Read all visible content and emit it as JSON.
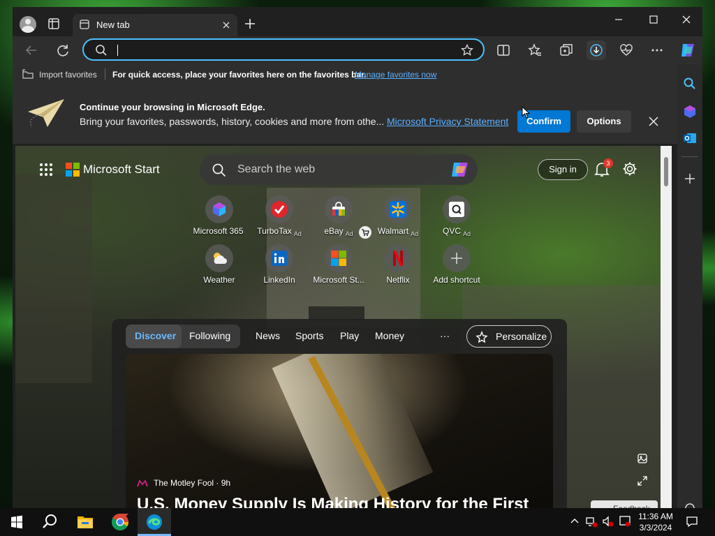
{
  "browser": {
    "tab_title": "New tab",
    "address_value": "",
    "address_placeholder": ""
  },
  "favorites_bar": {
    "import_label": "Import favorites",
    "hint_text": "For quick access, place your favorites here on the favorites bar.",
    "manage_link": "Manage favorites now"
  },
  "infobar": {
    "title": "Continue your browsing in Microsoft Edge.",
    "body": "Bring your favorites, passwords, history, cookies and more from othe...",
    "privacy_link": "Microsoft Privacy Statement",
    "confirm_label": "Confirm",
    "options_label": "Options"
  },
  "page": {
    "brand": "Microsoft Start",
    "search_placeholder": "Search the web",
    "sign_in_label": "Sign in",
    "notification_count": "3",
    "shortcuts": [
      {
        "label": "Microsoft 365",
        "ad": ""
      },
      {
        "label": "TurboTax",
        "ad": "Ad"
      },
      {
        "label": "eBay",
        "ad": "Ad"
      },
      {
        "label": "Walmart",
        "ad": "Ad"
      },
      {
        "label": "QVC",
        "ad": "Ad"
      },
      {
        "label": "Weather",
        "ad": ""
      },
      {
        "label": "LinkedIn",
        "ad": ""
      },
      {
        "label": "Microsoft St...",
        "ad": ""
      },
      {
        "label": "Netflix",
        "ad": ""
      },
      {
        "label": "Add shortcut",
        "ad": ""
      }
    ],
    "feed_tabs": [
      "Discover",
      "Following",
      "News",
      "Sports",
      "Play",
      "Money"
    ],
    "more_label": "···",
    "personalize_label": "Personalize",
    "article": {
      "source": "The Motley Fool · 9h",
      "headline": "U.S. Money Supply Is Making History for the First"
    },
    "feedback_label": "Feedback"
  },
  "taskbar": {
    "time": "11:36 AM",
    "date": "3/3/2024"
  },
  "colors": {
    "accent": "#0078d4",
    "address_border": "#4cc2ff",
    "link": "#5ab0ff"
  }
}
